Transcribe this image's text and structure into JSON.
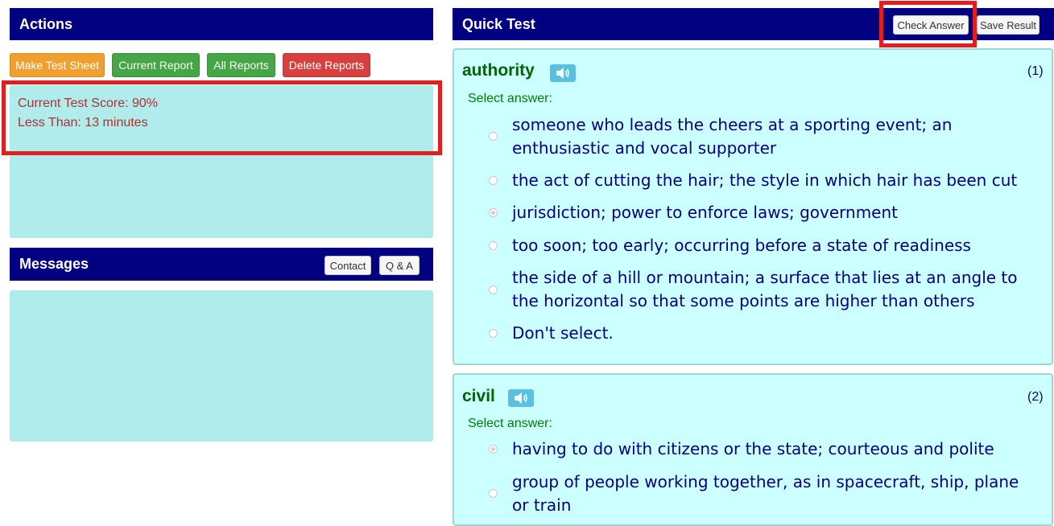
{
  "actions": {
    "title": "Actions",
    "buttons": {
      "make_test_sheet": "Make Test Sheet",
      "current_report": "Current Report",
      "all_reports": "All Reports",
      "delete_reports": "Delete Reports"
    },
    "score_line": "Current Test Score: 90%",
    "time_line": "Less Than: 13 minutes"
  },
  "messages": {
    "title": "Messages",
    "contact_label": "Contact",
    "qa_label": "Q & A"
  },
  "quick_test": {
    "title": "Quick Test",
    "check_answer_label": "Check Answer",
    "save_result_label": "Save Result",
    "select_label": "Select answer:",
    "questions": [
      {
        "word": "authority",
        "number": "(1)",
        "options": [
          {
            "text": "someone who leads the cheers at a sporting event; an enthusiastic and vocal supporter",
            "selected": false
          },
          {
            "text": "the act of cutting the hair; the style in which hair has been cut",
            "selected": false
          },
          {
            "text": "jurisdiction; power to enforce laws; government",
            "selected": true
          },
          {
            "text": "too soon; too early; occurring before a state of readiness",
            "selected": false
          },
          {
            "text": "the side of a hill or mountain; a surface that lies at an angle to the horizontal so that some points are higher than others",
            "selected": false
          },
          {
            "text": "Don't select.",
            "selected": false
          }
        ]
      },
      {
        "word": "civil",
        "number": "(2)",
        "options": [
          {
            "text": "having to do with citizens or the state; courteous and polite",
            "selected": true
          },
          {
            "text": "group of people working together, as in spacecraft, ship, plane or train",
            "selected": false
          }
        ]
      }
    ]
  },
  "colors": {
    "header_bg": "#000080",
    "panel_bg": "#b0ecec",
    "card_bg": "#ccffff",
    "highlight": "#e02020"
  },
  "icons": {
    "speaker": "speaker-icon"
  }
}
